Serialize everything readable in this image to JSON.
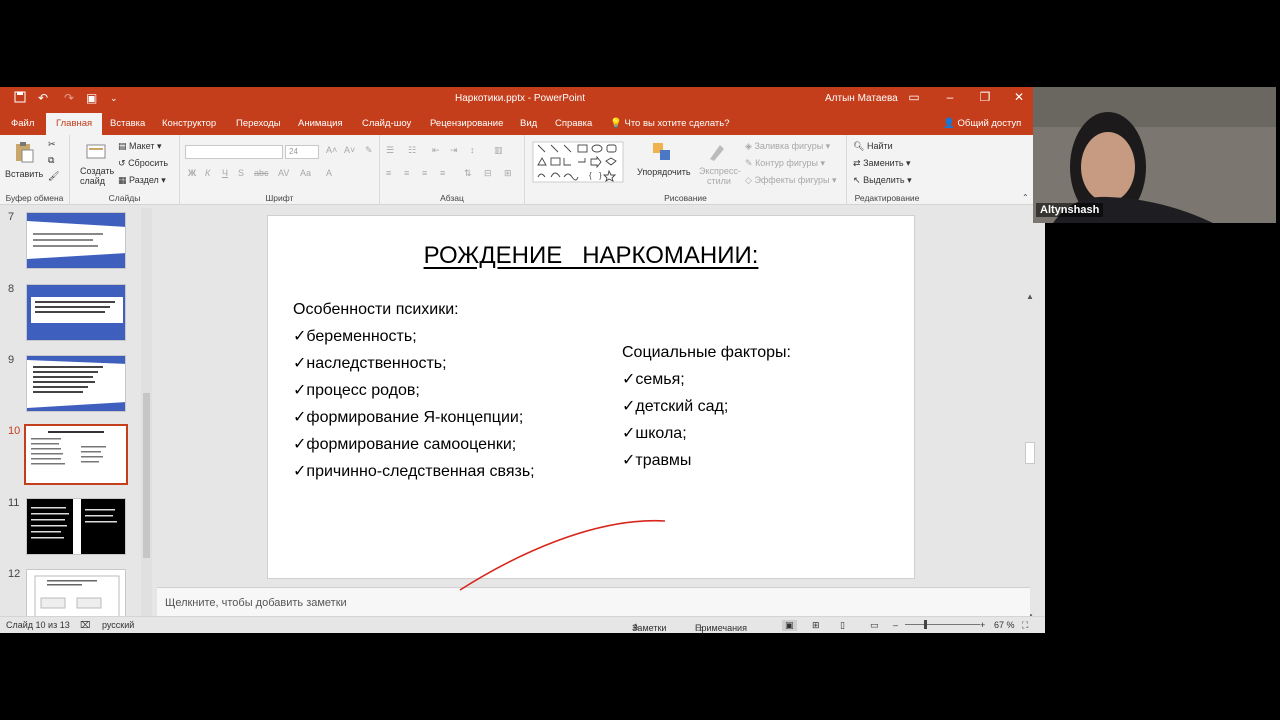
{
  "window": {
    "title": "Наркотики.pptx  -  PowerPoint",
    "user": "Алтын Матаева"
  },
  "tabs": [
    "Файл",
    "Главная",
    "Вставка",
    "Конструктор",
    "Переходы",
    "Анимация",
    "Слайд-шоу",
    "Рецензирование",
    "Вид",
    "Справка"
  ],
  "tell_me": "Что вы хотите сделать?",
  "share": "Общий доступ",
  "ribbon": {
    "clipboard": {
      "paste": "Вставить",
      "label": "Буфер обмена"
    },
    "slides": {
      "new_slide": "Создать слайд",
      "layout": "Макет",
      "reset": "Сбросить",
      "section": "Раздел",
      "label": "Слайды"
    },
    "font": {
      "size": "24",
      "bold": "Ж",
      "italic": "К",
      "underline": "Ч",
      "strike": "S",
      "label": "Шрифт"
    },
    "paragraph": {
      "label": "Абзац"
    },
    "drawing": {
      "arrange": "Упорядочить",
      "styles": "Экспресс-стили",
      "fill": "Заливка фигуры",
      "outline": "Контур фигуры",
      "effects": "Эффекты фигуры",
      "label": "Рисование"
    },
    "editing": {
      "find": "Найти",
      "replace": "Заменить",
      "select": "Выделить",
      "label": "Редактирование"
    }
  },
  "slides_panel": [
    "7",
    "8",
    "9",
    "10",
    "11",
    "12"
  ],
  "slide": {
    "title": "РОЖДЕНИЕ   НАРКОМАНИИ:",
    "left_heading": "Особенности психики:",
    "left_items": [
      "беременность;",
      "наследственность;",
      "процесс родов;",
      "формирование Я-концепции;",
      "формирование самооценки;",
      "причинно-следственная связь;"
    ],
    "right_heading": "Социальные факторы:",
    "right_items": [
      "семья;",
      "детский сад;",
      "школа;",
      "травмы"
    ]
  },
  "notes_placeholder": "Щелкните, чтобы добавить заметки",
  "status": {
    "slide_info": "Слайд 10 из 13",
    "language": "русский",
    "notes": "Заметки",
    "comments": "Примечания",
    "zoom": "67 %"
  },
  "webcam": {
    "name": "Altynshash"
  },
  "colors": {
    "accent": "#c43e1c",
    "thumb_blue": "#3f5fbf"
  }
}
